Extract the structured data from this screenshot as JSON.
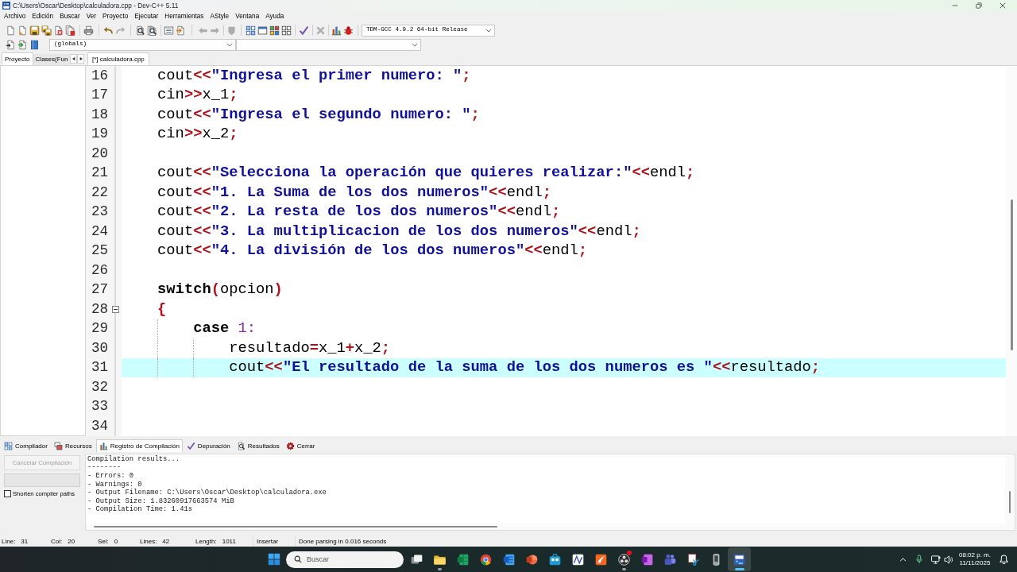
{
  "window": {
    "title": "C:\\Users\\Oscar\\Desktop\\calculadora.cpp - Dev-C++ 5.11"
  },
  "menu": [
    "Archivo",
    "Edición",
    "Buscar",
    "Ver",
    "Proyecto",
    "Ejecutar",
    "Herramientas",
    "AStyle",
    "Ventana",
    "Ayuda"
  ],
  "toolbar": {
    "groups": [
      {
        "buttons": [
          {
            "kind": "new",
            "disabled": false
          },
          {
            "kind": "open",
            "disabled": false
          },
          {
            "kind": "save",
            "disabled": false
          },
          {
            "kind": "save-all",
            "disabled": false
          },
          {
            "kind": "close",
            "disabled": false
          },
          {
            "kind": "close-all",
            "disabled": false
          }
        ]
      },
      {
        "buttons": [
          {
            "kind": "print",
            "disabled": false
          }
        ]
      },
      {
        "buttons": [
          {
            "kind": "undo",
            "disabled": false
          },
          {
            "kind": "redo",
            "disabled": true
          }
        ]
      },
      {
        "buttons": [
          {
            "kind": "find",
            "disabled": false
          },
          {
            "kind": "replace",
            "disabled": false
          }
        ]
      },
      {
        "buttons": [
          {
            "kind": "indent",
            "disabled": false
          },
          {
            "kind": "unindent",
            "disabled": false
          }
        ]
      },
      {
        "buttons": [
          {
            "kind": "back",
            "disabled": true
          },
          {
            "kind": "forward",
            "disabled": true
          }
        ]
      },
      {
        "buttons": [
          {
            "kind": "bookmark",
            "disabled": true
          }
        ]
      },
      {
        "buttons": [
          {
            "kind": "compile",
            "disabled": false
          },
          {
            "kind": "run",
            "disabled": false
          },
          {
            "kind": "compile-run",
            "disabled": false
          },
          {
            "kind": "rebuild",
            "disabled": false
          }
        ]
      },
      {
        "buttons": [
          {
            "kind": "check",
            "disabled": false
          }
        ]
      },
      {
        "buttons": [
          {
            "kind": "stop",
            "disabled": true
          }
        ]
      },
      {
        "buttons": [
          {
            "kind": "chart",
            "disabled": false
          },
          {
            "kind": "debug",
            "disabled": false
          }
        ]
      }
    ],
    "compiler_select": {
      "value": "TDM-GCC 4.9.2 64-bit Release"
    }
  },
  "toolbar_2": {
    "buttons": [
      {
        "kind": "page-import"
      },
      {
        "kind": "page-add"
      },
      {
        "kind": "book"
      }
    ],
    "scope_select": {
      "value": "(globals)"
    }
  },
  "left_tabs": [
    {
      "label": "Proyecto",
      "selected": true
    },
    {
      "label": "Clases(Fun",
      "selected": false
    }
  ],
  "editor": {
    "tabs": [
      {
        "label": "[*] calculadora.cpp",
        "selected": true
      }
    ],
    "lines": [
      {
        "number": "16",
        "current": false,
        "tokens": [
          {
            "kind": "plain",
            "text": "cout"
          },
          {
            "kind": "operator",
            "text": "<<"
          },
          {
            "kind": "string",
            "text": "\"Ingresa el primer numero: \""
          },
          {
            "kind": "operator",
            "text": ";"
          }
        ]
      },
      {
        "number": "17",
        "current": false,
        "tokens": [
          {
            "kind": "plain",
            "text": "cin"
          },
          {
            "kind": "operator",
            "text": ">>"
          },
          {
            "kind": "plain",
            "text": "x_1"
          },
          {
            "kind": "operator",
            "text": ";"
          }
        ]
      },
      {
        "number": "18",
        "current": false,
        "tokens": [
          {
            "kind": "plain",
            "text": "cout"
          },
          {
            "kind": "operator",
            "text": "<<"
          },
          {
            "kind": "string",
            "text": "\"Ingresa el segundo numero: \""
          },
          {
            "kind": "operator",
            "text": ";"
          }
        ]
      },
      {
        "number": "19",
        "current": false,
        "tokens": [
          {
            "kind": "plain",
            "text": "cin"
          },
          {
            "kind": "operator",
            "text": ">>"
          },
          {
            "kind": "plain",
            "text": "x_2"
          },
          {
            "kind": "operator",
            "text": ";"
          }
        ]
      },
      {
        "number": "20",
        "current": false
      },
      {
        "number": "21",
        "current": false,
        "tokens": [
          {
            "kind": "plain",
            "text": "cout"
          },
          {
            "kind": "operator",
            "text": "<<"
          },
          {
            "kind": "string",
            "text": "\"Selecciona la operación que quieres realizar:\""
          },
          {
            "kind": "operator",
            "text": "<<"
          },
          {
            "kind": "plain",
            "text": "endl"
          },
          {
            "kind": "operator",
            "text": ";"
          }
        ]
      },
      {
        "number": "22",
        "current": false,
        "tokens": [
          {
            "kind": "plain",
            "text": "cout"
          },
          {
            "kind": "operator",
            "text": "<<"
          },
          {
            "kind": "string",
            "text": "\"1. La Suma de los dos numeros\""
          },
          {
            "kind": "operator",
            "text": "<<"
          },
          {
            "kind": "plain",
            "text": "endl"
          },
          {
            "kind": "operator",
            "text": ";"
          }
        ]
      },
      {
        "number": "23",
        "current": false,
        "tokens": [
          {
            "kind": "plain",
            "text": "cout"
          },
          {
            "kind": "operator",
            "text": "<<"
          },
          {
            "kind": "string",
            "text": "\"2. La resta de los dos numeros\""
          },
          {
            "kind": "operator",
            "text": "<<"
          },
          {
            "kind": "plain",
            "text": "endl"
          },
          {
            "kind": "operator",
            "text": ";"
          }
        ]
      },
      {
        "number": "24",
        "current": false,
        "tokens": [
          {
            "kind": "plain",
            "text": "cout"
          },
          {
            "kind": "operator",
            "text": "<<"
          },
          {
            "kind": "string",
            "text": "\"3. La multiplicacion de los dos numeros\""
          },
          {
            "kind": "operator",
            "text": "<<"
          },
          {
            "kind": "plain",
            "text": "endl"
          },
          {
            "kind": "operator",
            "text": ";"
          }
        ]
      },
      {
        "number": "25",
        "current": false,
        "tokens": [
          {
            "kind": "plain",
            "text": "cout"
          },
          {
            "kind": "operator",
            "text": "<<"
          },
          {
            "kind": "string",
            "text": "\"4. La división de los dos numeros\""
          },
          {
            "kind": "operator",
            "text": "<<"
          },
          {
            "kind": "plain",
            "text": "endl"
          },
          {
            "kind": "operator",
            "text": ";"
          }
        ]
      },
      {
        "number": "26",
        "current": false
      },
      {
        "number": "27",
        "current": false,
        "tokens": [
          {
            "kind": "keyword",
            "text": "switch"
          },
          {
            "kind": "operator",
            "text": "("
          },
          {
            "kind": "plain",
            "text": "opcion"
          },
          {
            "kind": "operator",
            "text": ")"
          }
        ]
      },
      {
        "number": "28",
        "current": false,
        "expanded": true,
        "tokens": [
          {
            "kind": "operator",
            "text": "{"
          }
        ],
        "children": [
          {
            "number": "29",
            "current": false,
            "tokens": [
              {
                "kind": "keyword",
                "text": "case"
              },
              {
                "kind": "number",
                "text": " 1:"
              }
            ],
            "children": [
              {
                "number": "30",
                "current": false,
                "tokens": [
                  {
                    "kind": "plain",
                    "text": "resultado"
                  },
                  {
                    "kind": "operator",
                    "text": "="
                  },
                  {
                    "kind": "plain",
                    "text": "x_1"
                  },
                  {
                    "kind": "operator",
                    "text": "+"
                  },
                  {
                    "kind": "plain",
                    "text": "x_2"
                  },
                  {
                    "kind": "operator",
                    "text": ";"
                  }
                ]
              },
              {
                "number": "31",
                "current": true,
                "tokens": [
                  {
                    "kind": "plain",
                    "text": "cout"
                  },
                  {
                    "kind": "operator",
                    "text": "<<"
                  },
                  {
                    "kind": "string",
                    "text": "\"El resultado de la suma de los dos numeros es \""
                  },
                  {
                    "kind": "operator",
                    "text": "<<"
                  },
                  {
                    "kind": "plain",
                    "text": "resultado"
                  },
                  {
                    "kind": "operator",
                    "text": ";"
                  }
                ]
              }
            ]
          }
        ]
      },
      {
        "number": "32",
        "current": false
      },
      {
        "number": "33",
        "current": false
      },
      {
        "number": "34",
        "current": false
      }
    ]
  },
  "bottom_tabs": [
    {
      "kind": "compiler",
      "label": "Compilador",
      "selected": false
    },
    {
      "kind": "resources",
      "label": "Recursos",
      "selected": false
    },
    {
      "kind": "log",
      "label": "Registro de Compilación",
      "selected": true
    },
    {
      "kind": "debug",
      "label": "Depuración",
      "selected": false
    },
    {
      "kind": "results",
      "label": "Resultados",
      "selected": false
    },
    {
      "kind": "close",
      "label": "Cerrar",
      "selected": false
    }
  ],
  "compile_panel": {
    "cancel_button": {
      "label": "Cancelar Compilación",
      "disabled": true
    },
    "progress": {
      "level": 0
    },
    "shorten_paths": {
      "label": "Shorten compiler paths",
      "checked": false
    },
    "log": [
      "Compilation results...",
      "--------",
      "- Errors: 0",
      "- Warnings: 0",
      "- Output Filename: C:\\Users\\Oscar\\Desktop\\calculadora.exe",
      "- Output Size: 1.83260917663574 MiB",
      "- Compilation Time: 1.41s"
    ]
  },
  "status_bar": {
    "fields": [
      {
        "label": "Line:",
        "value": "31"
      },
      {
        "label": "Col:",
        "value": "20"
      },
      {
        "label": "Sel:",
        "value": "0"
      },
      {
        "label": "Lines:",
        "value": "42"
      },
      {
        "label": "Length:",
        "value": "1011"
      }
    ],
    "mode": "Insertar",
    "message": "Done parsing in 0.016 seconds"
  },
  "taskbar": {
    "search": {
      "placeholder": "Buscar"
    },
    "apps": [
      {
        "kind": "task-view",
        "running": false,
        "active": false,
        "badge": false
      },
      {
        "kind": "folder",
        "running": true,
        "active": false,
        "badge": false
      },
      {
        "kind": "spreadsheet",
        "running": false,
        "active": false,
        "badge": false
      },
      {
        "kind": "browser",
        "running": false,
        "active": false,
        "badge": false
      },
      {
        "kind": "word",
        "running": false,
        "active": false,
        "badge": false
      },
      {
        "kind": "slides",
        "running": false,
        "active": false,
        "badge": false
      },
      {
        "kind": "store",
        "running": false,
        "active": false,
        "badge": false
      },
      {
        "kind": "graph",
        "running": false,
        "active": false,
        "badge": false
      },
      {
        "kind": "swoosh",
        "running": false,
        "active": false,
        "badge": false
      },
      {
        "kind": "recorder",
        "running": true,
        "active": false,
        "badge": true
      },
      {
        "kind": "notebook",
        "running": false,
        "active": false,
        "badge": false
      },
      {
        "kind": "people",
        "running": false,
        "active": false,
        "badge": false
      },
      {
        "kind": "snipping",
        "running": false,
        "active": false,
        "badge": false
      },
      {
        "kind": "phone",
        "running": false,
        "active": false,
        "badge": false
      },
      {
        "kind": "ide",
        "running": true,
        "active": true,
        "badge": false
      }
    ],
    "clock": {
      "time": "08:02 p. m.",
      "date": "11/11/2025"
    }
  }
}
